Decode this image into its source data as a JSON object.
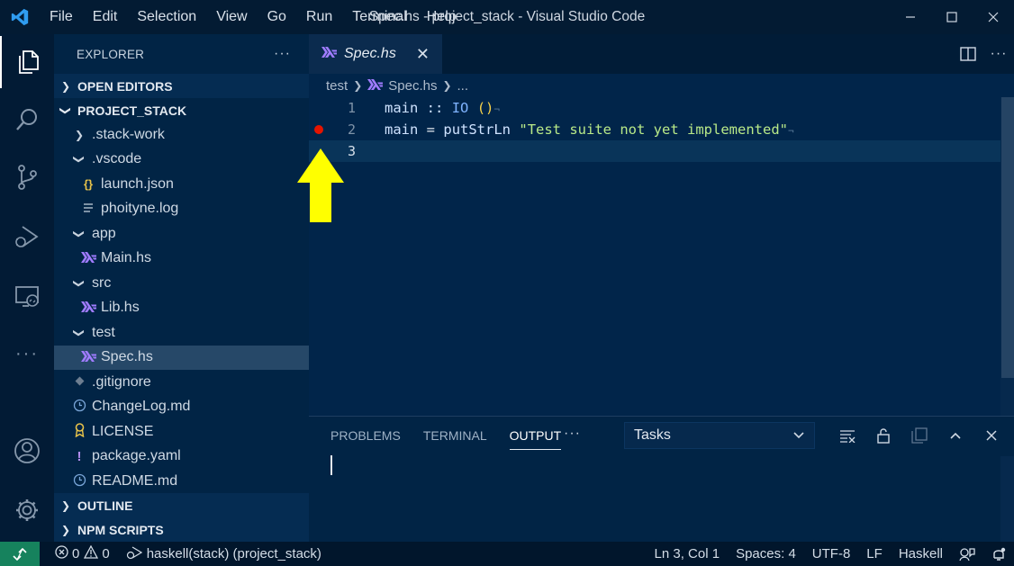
{
  "titlebar": {
    "menu": [
      "File",
      "Edit",
      "Selection",
      "View",
      "Go",
      "Run",
      "Terminal",
      "Help"
    ],
    "title": "Spec.hs - project_stack - Visual Studio Code"
  },
  "sidebar": {
    "header": "EXPLORER",
    "more": "···",
    "sections": {
      "open_editors": "OPEN EDITORS",
      "project": "PROJECT_STACK",
      "outline": "OUTLINE",
      "npm_scripts": "NPM SCRIPTS"
    },
    "tree": [
      {
        "label": ".stack-work",
        "kind": "folder-collapsed",
        "depth": 0
      },
      {
        "label": ".vscode",
        "kind": "folder-expanded",
        "depth": 0
      },
      {
        "label": "launch.json",
        "kind": "json-file",
        "depth": 1
      },
      {
        "label": "phoityne.log",
        "kind": "log-file",
        "depth": 1
      },
      {
        "label": "app",
        "kind": "folder-expanded",
        "depth": 0
      },
      {
        "label": "Main.hs",
        "kind": "haskell-file",
        "depth": 1
      },
      {
        "label": "src",
        "kind": "folder-expanded",
        "depth": 0
      },
      {
        "label": "Lib.hs",
        "kind": "haskell-file",
        "depth": 1
      },
      {
        "label": "test",
        "kind": "folder-expanded",
        "depth": 0
      },
      {
        "label": "Spec.hs",
        "kind": "haskell-file",
        "depth": 1,
        "selected": true
      },
      {
        "label": ".gitignore",
        "kind": "git-file",
        "depth": 0
      },
      {
        "label": "ChangeLog.md",
        "kind": "markdown-file",
        "depth": 0
      },
      {
        "label": "LICENSE",
        "kind": "license-file",
        "depth": 0
      },
      {
        "label": "package.yaml",
        "kind": "yaml-file",
        "depth": 0
      },
      {
        "label": "README.md",
        "kind": "markdown-file",
        "depth": 0
      }
    ]
  },
  "editor": {
    "tab_label": "Spec.hs",
    "tab_close": "✕",
    "breadcrumb": {
      "folder": "test",
      "file": "Spec.hs",
      "more": "..."
    },
    "lines": [
      {
        "number": "1"
      },
      {
        "number": "2",
        "breakpoint": true
      },
      {
        "number": "3",
        "current": true
      }
    ],
    "code": {
      "l1_name": "main",
      "l1_op": "::",
      "l1_type": "IO",
      "l1_unit": "()",
      "l2_name": "main",
      "l2_op": "=",
      "l2_fn": "putStrLn",
      "l2_str": "\"Test suite not yet implemented\"",
      "eol_mark": "¬"
    }
  },
  "panel": {
    "tabs": [
      "PROBLEMS",
      "TERMINAL",
      "OUTPUT"
    ],
    "active_tab": "OUTPUT",
    "more": "···",
    "task_select_value": "Tasks"
  },
  "statusbar": {
    "errors": "0",
    "warnings": "0",
    "debug_config": "haskell(stack) (project_stack)",
    "position": "Ln 3, Col 1",
    "spaces": "Spaces: 4",
    "encoding": "UTF-8",
    "eol": "LF",
    "language": "Haskell"
  },
  "colors": {
    "accent_breakpoint": "#e51400",
    "annotation_arrow": "#ffff00",
    "remote_indicator": "#16825d",
    "haskell_icon": "#a07cff"
  }
}
